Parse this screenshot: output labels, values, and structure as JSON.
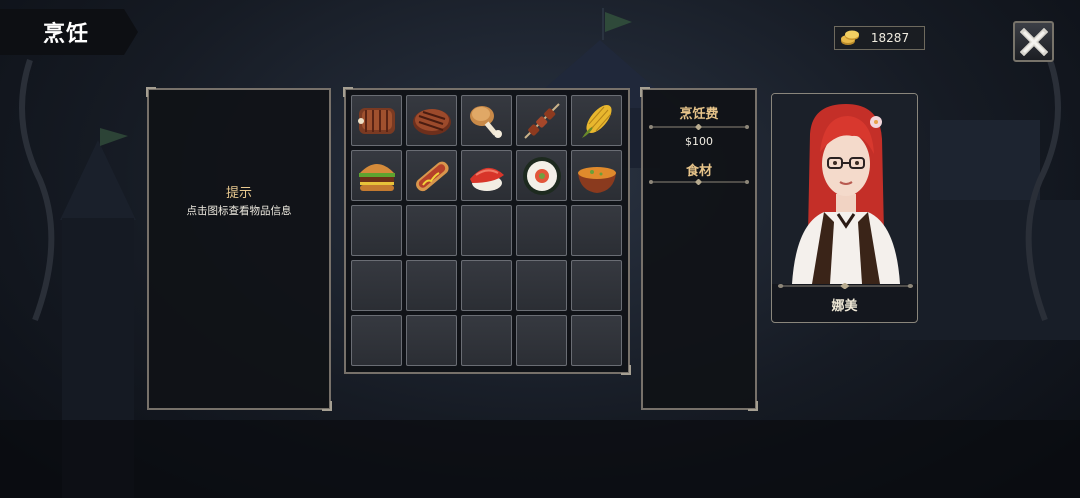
{
  "title": "烹饪",
  "currency": {
    "icon": "gold-coin-icon",
    "amount": "18287"
  },
  "close": {
    "icon": "close-x-icon"
  },
  "hint": {
    "title": "提示",
    "text": "点击图标查看物品信息"
  },
  "cooking": {
    "fee_label": "烹饪费",
    "fee_value": "$100",
    "ingredients_label": "食材"
  },
  "character": {
    "name": "娜美",
    "portrait": "red-haired-glasses-girl-portrait"
  },
  "recipes": [
    {
      "icon": "ribs-icon"
    },
    {
      "icon": "steak-icon"
    },
    {
      "icon": "drumstick-icon"
    },
    {
      "icon": "skewer-icon"
    },
    {
      "icon": "corn-icon"
    },
    {
      "icon": "burger-icon"
    },
    {
      "icon": "hotdog-icon"
    },
    {
      "icon": "tuna-sushi-icon"
    },
    {
      "icon": "sushi-roll-icon"
    },
    {
      "icon": "soup-icon"
    }
  ],
  "grid": {
    "rows": 5,
    "cols": 5
  },
  "colors": {
    "accent_gold": "#e7c48a",
    "panel_border": "#77716a",
    "panel_bg": "#101217"
  }
}
